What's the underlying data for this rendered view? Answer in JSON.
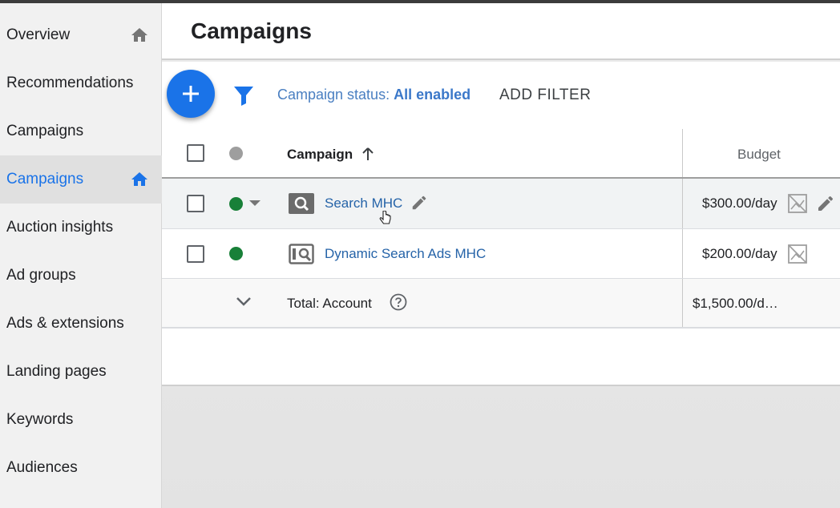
{
  "sidebar": {
    "items": [
      {
        "label": "Overview",
        "icon": "home-icon"
      },
      {
        "label": "Recommendations"
      },
      {
        "label": "Campaigns"
      },
      {
        "label": "Campaigns",
        "icon": "home-icon",
        "active": true
      },
      {
        "label": "Auction insights"
      },
      {
        "label": "Ad groups"
      },
      {
        "label": "Ads & extensions"
      },
      {
        "label": "Landing pages"
      },
      {
        "label": "Keywords"
      },
      {
        "label": "Audiences"
      }
    ]
  },
  "header": {
    "title": "Campaigns"
  },
  "toolbar": {
    "filter_prefix": "Campaign status: ",
    "filter_value": "All enabled",
    "add_filter_label": "ADD FILTER"
  },
  "table": {
    "columns": {
      "campaign": "Campaign",
      "budget": "Budget"
    },
    "rows": [
      {
        "name": "Search MHC",
        "budget": "$300.00/day",
        "status_color": "#188038"
      },
      {
        "name": "Dynamic Search Ads MHC",
        "budget": "$200.00/day",
        "status_color": "#188038"
      }
    ],
    "total": {
      "label": "Total: Account",
      "budget": "$1,500.00/d…"
    }
  },
  "colors": {
    "accent": "#1a73e8",
    "link": "#2563a8",
    "enabled_dot": "#188038"
  }
}
